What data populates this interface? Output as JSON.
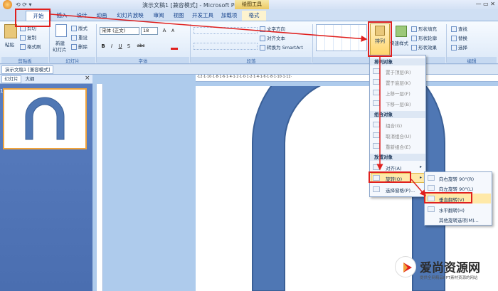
{
  "window": {
    "title": "演示文稿1 [兼容模式] - Microsoft PowerPoint",
    "contextual_tab": "绘图工具",
    "controls": "— ▭ ✕"
  },
  "tabs": [
    "开始",
    "插入",
    "设计",
    "动画",
    "幻灯片放映",
    "审阅",
    "视图",
    "开发工具",
    "加载项",
    "格式"
  ],
  "ribbon": {
    "clipboard": {
      "paste": "粘贴",
      "cut": "剪切",
      "copy": "复制",
      "format_painter": "格式刷",
      "label": "剪贴板"
    },
    "slides": {
      "new_slide_1": "新建",
      "new_slide_2": "幻灯片",
      "layout": "版式",
      "reset": "重设",
      "delete": "删除",
      "label": "幻灯片"
    },
    "font": {
      "name": "宋体 (正文)",
      "size": "18",
      "label": "字体",
      "grow": "A",
      "shrink": "A",
      "bold": "B",
      "italic": "I",
      "underline": "U",
      "shadow": "S",
      "strike": "abc"
    },
    "paragraph": {
      "text_direction": "文字方向",
      "align_text": "对齐文本",
      "smartart": "转换为 SmartArt",
      "label": "段落"
    },
    "drawing": {
      "arrange": "排列",
      "quick_styles": "快速样式",
      "shape_fill": "形状填充",
      "shape_outline": "形状轮廓",
      "shape_effects": "形状效果",
      "label": "绘图"
    },
    "editing": {
      "find": "查找",
      "replace": "替换",
      "select": "选择",
      "label": "编辑"
    }
  },
  "doc_tab": "演示文稿1 [兼容模式]",
  "left_pane": {
    "tab_slides": "幻灯片",
    "tab_outline": "大纲",
    "close": "×",
    "thumb_number": "1"
  },
  "arrange_menu": {
    "head_order": "排列对象",
    "bring_to_front": "置于顶层(R)",
    "send_to_back": "置于底层(K)",
    "bring_forward": "上移一层(F)",
    "send_backward": "下移一层(B)",
    "head_group": "组合对象",
    "group": "组合(G)",
    "ungroup": "取消组合(U)",
    "regroup": "重新组合(E)",
    "head_position": "放置对象",
    "align": "对齐(A)",
    "rotate": "旋转(O)",
    "selection_pane": "选择窗格(P)..."
  },
  "rotate_menu": {
    "right90": "向右旋转 90°(R)",
    "left90": "向左旋转 90°(L)",
    "flip_vertical": "垂直翻转(V)",
    "flip_horizontal": "水平翻转(H)",
    "more": "其他旋转选项(M)..."
  },
  "watermark": {
    "name": "爱尚资源网",
    "tagline": "提供全网精品PPT素材资源的网站"
  },
  "colors": {
    "shape": "#4f77b4",
    "shape_stroke": "#3a5f96",
    "highlight": "#e0201e",
    "accent": "#f0a33c"
  }
}
